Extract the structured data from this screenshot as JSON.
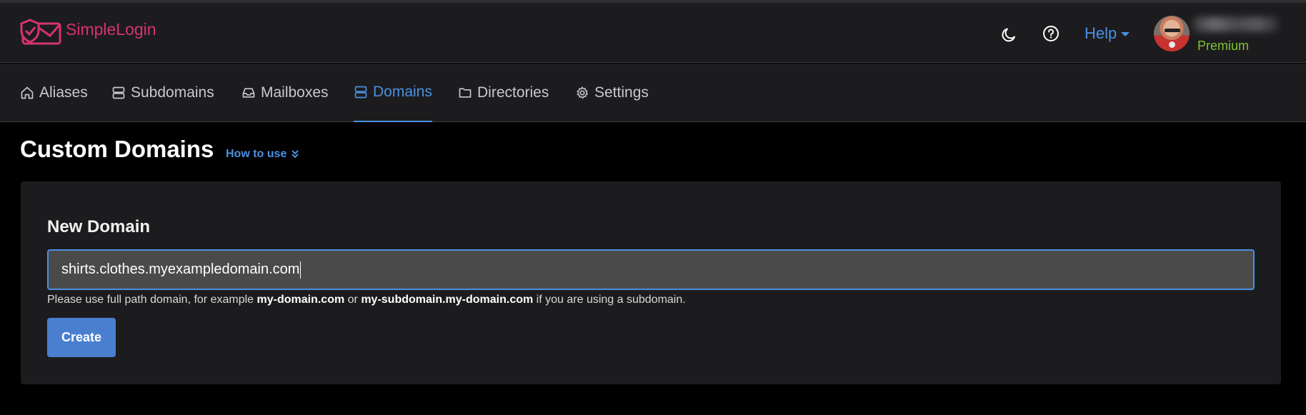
{
  "app": {
    "name": "SimpleLogin"
  },
  "header": {
    "help_label": "Help",
    "user_plan": "Premium",
    "icons": [
      "moon-icon",
      "question-circle-icon"
    ]
  },
  "nav": {
    "items": [
      {
        "label": "Aliases",
        "icon": "home-icon",
        "active": false
      },
      {
        "label": "Subdomains",
        "icon": "server-icon",
        "active": false
      },
      {
        "label": "Mailboxes",
        "icon": "inbox-icon",
        "active": false
      },
      {
        "label": "Domains",
        "icon": "server-icon",
        "active": true
      },
      {
        "label": "Directories",
        "icon": "folder-icon",
        "active": false
      },
      {
        "label": "Settings",
        "icon": "gear-icon",
        "active": false
      }
    ]
  },
  "page": {
    "title": "Custom Domains",
    "how_to_use": "How to use"
  },
  "new_domain": {
    "title": "New Domain",
    "input_value": "shirts.clothes.myexampledomain.com",
    "hint_prefix": "Please use full path domain, for example ",
    "hint_example1": "my-domain.com",
    "hint_or": " or ",
    "hint_example2": "my-subdomain.my-domain.com",
    "hint_suffix": " if you are using a subdomain.",
    "create_label": "Create"
  },
  "colors": {
    "accent": "#4a90e2",
    "brand": "#d6336c",
    "premium": "#7fc234",
    "button": "#4a7fd0"
  }
}
